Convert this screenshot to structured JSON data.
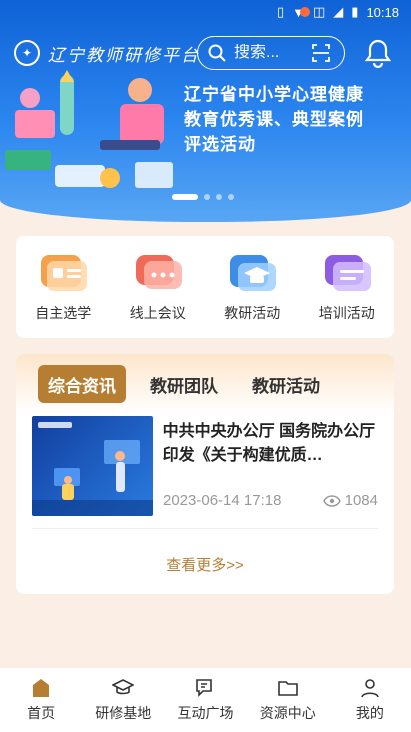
{
  "status_bar": {
    "time": "10:18"
  },
  "header": {
    "logo_text": "辽宁教师研修平台",
    "search_placeholder": "搜索...",
    "banner_line1": "辽宁省中小学心理健康",
    "banner_line2": "教育优秀课、典型案例",
    "banner_line3": "评选活动",
    "carousel_pages": 4,
    "carousel_active": 1
  },
  "quick_entries": [
    {
      "label": "自主选学",
      "icon": "id-card-icon",
      "color": "#f0a04b"
    },
    {
      "label": "线上会议",
      "icon": "chat-bubble-icon",
      "color": "#f06a5a"
    },
    {
      "label": "教研活动",
      "icon": "graduation-cap-icon",
      "color": "#3d8de6"
    },
    {
      "label": "培训活动",
      "icon": "message-board-icon",
      "color": "#8e5ce0"
    }
  ],
  "news": {
    "tabs": [
      "综合资讯",
      "教研团队",
      "教研活动"
    ],
    "active_tab": "综合资讯",
    "article": {
      "title": "中共中央办公厅 国务院办公厅印发《关于构建优质…",
      "date": "2023-06-14 17:18",
      "views": "1084"
    },
    "more_label": "查看更多>>"
  },
  "bottom_nav": [
    {
      "label": "首页",
      "icon": "home-icon"
    },
    {
      "label": "研修基地",
      "icon": "mortarboard-icon"
    },
    {
      "label": "互动广场",
      "icon": "chat-icon"
    },
    {
      "label": "资源中心",
      "icon": "folder-icon"
    },
    {
      "label": "我的",
      "icon": "user-icon"
    }
  ],
  "colors": {
    "accent": "#b67e33",
    "banner": "#1f74e4",
    "background": "#fbeee4"
  }
}
